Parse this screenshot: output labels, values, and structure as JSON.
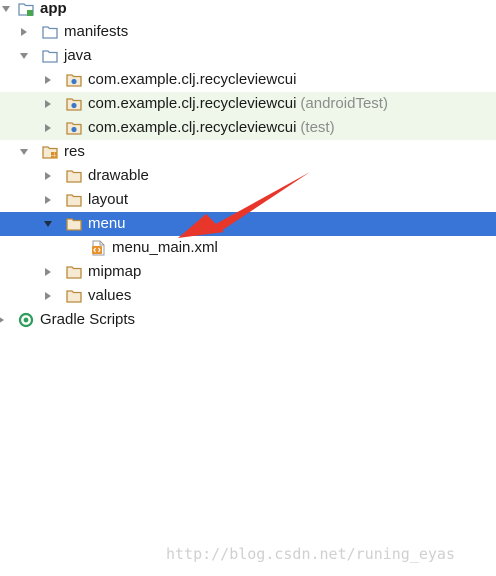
{
  "tree": {
    "app": "app",
    "manifests": "manifests",
    "java": "java",
    "pkg_main": "com.example.clj.recycleviewcui",
    "pkg_android_test": "com.example.clj.recycleviewcui",
    "pkg_android_test_suffix": "(androidTest)",
    "pkg_test": "com.example.clj.recycleviewcui",
    "pkg_test_suffix": "(test)",
    "res": "res",
    "drawable": "drawable",
    "layout": "layout",
    "menu": "menu",
    "menu_main_xml": "menu_main.xml",
    "mipmap": "mipmap",
    "values": "values",
    "gradle_scripts": "Gradle Scripts"
  },
  "watermark": "http://blog.csdn.net/runing_eyas",
  "colors": {
    "selection": "#3875d6",
    "test_tint": "#eef7e9",
    "annotation_arrow": "#e8362b",
    "folder_java": "#d9a148",
    "folder_res": "#c9a36a"
  }
}
